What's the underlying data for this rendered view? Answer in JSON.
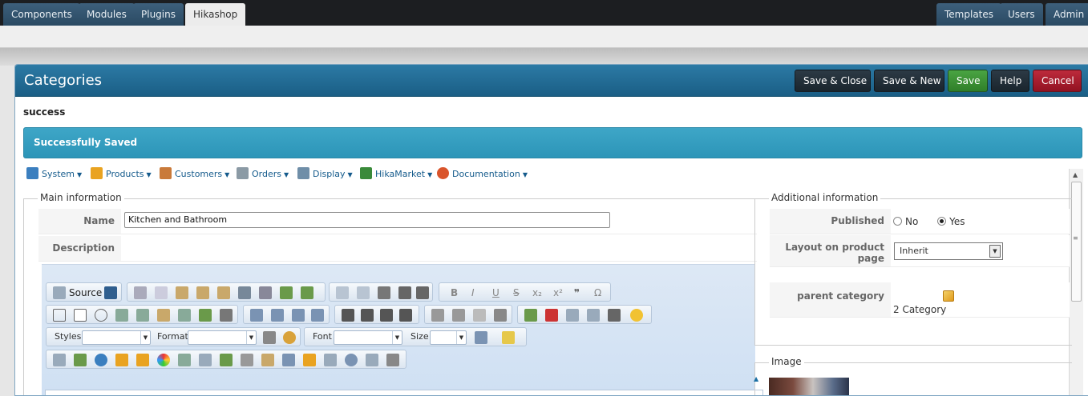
{
  "topnav": {
    "left_tabs": [
      "Components",
      "Modules",
      "Plugins",
      "Hikashop"
    ],
    "active_tab": "Hikashop",
    "right_tabs": [
      "Templates",
      "Users",
      "Admin"
    ]
  },
  "header": {
    "title": "Categories",
    "buttons": {
      "save_close": "Save & Close",
      "save_new": "Save & New",
      "save": "Save",
      "help": "Help",
      "cancel": "Cancel"
    }
  },
  "message": {
    "label": "success",
    "alert": "Successfully Saved"
  },
  "hikamenu": [
    {
      "label": "System",
      "icon": "tools-icon",
      "color": "#3b7fbf"
    },
    {
      "label": "Products",
      "icon": "box-icon",
      "color": "#e9a321"
    },
    {
      "label": "Customers",
      "icon": "users-icon",
      "color": "#c97a3a"
    },
    {
      "label": "Orders",
      "icon": "clipboard-icon",
      "color": "#8b9aa5"
    },
    {
      "label": "Display",
      "icon": "display-icon",
      "color": "#6f8ea8"
    },
    {
      "label": "HikaMarket",
      "icon": "market-icon",
      "color": "#3a8a3a"
    },
    {
      "label": "Documentation",
      "icon": "lifebuoy-icon",
      "color": "#d9542b"
    }
  ],
  "main_info": {
    "legend": "Main information",
    "name_label": "Name",
    "name_value": "Kitchen and Bathroom",
    "description_label": "Description"
  },
  "editor": {
    "source_label": "Source",
    "styles_label": "Styles",
    "format_label": "Format",
    "font_label": "Font",
    "size_label": "Size",
    "glyph_bold": "B",
    "glyph_italic": "I",
    "glyph_underline": "U",
    "glyph_strike": "S",
    "glyph_subscript": "x₂",
    "glyph_superscript": "x²",
    "glyph_quote": "❞",
    "glyph_omega": "Ω"
  },
  "additional_info": {
    "legend": "Additional information",
    "published_label": "Published",
    "published_options": [
      "No",
      "Yes"
    ],
    "published_value": "Yes",
    "layout_label": "Layout on product page",
    "layout_value": "Inherit",
    "parent_label": "parent category",
    "parent_value": "2 Category"
  },
  "image_section": {
    "legend": "Image"
  }
}
